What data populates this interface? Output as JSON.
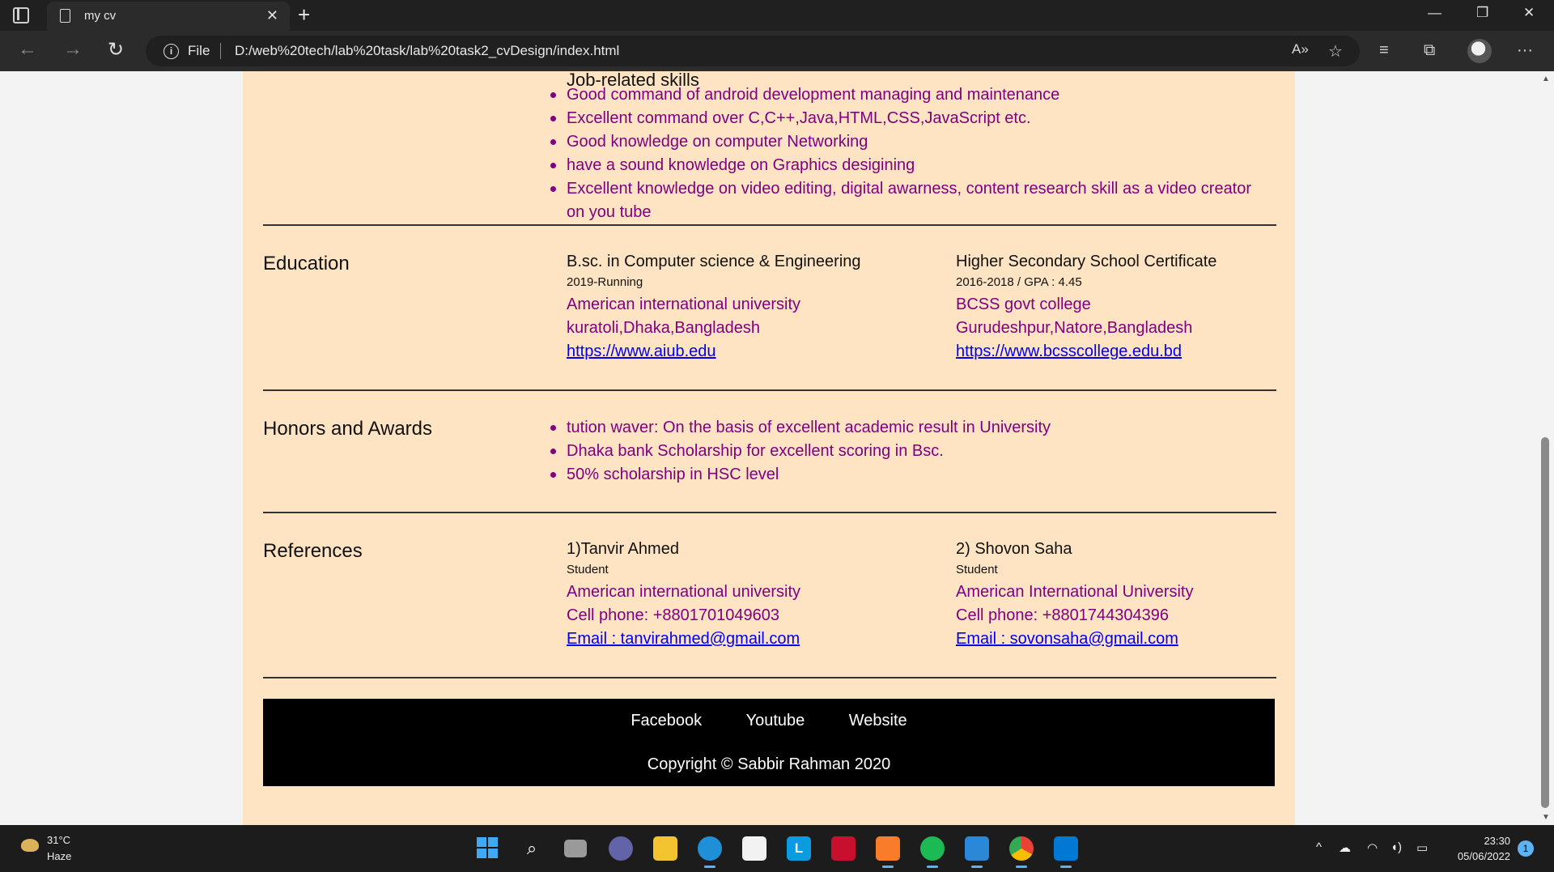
{
  "browser": {
    "tab_title": "my cv",
    "address_prefix": "File",
    "url": "D:/web%20tech/lab%20task/lab%20task2_cvDesign/index.html"
  },
  "skills": {
    "heading": "Job-related skills",
    "items": [
      "Good command of android development managing and maintenance",
      "Excellent command over C,C++,Java,HTML,CSS,JavaScript etc.",
      "Good knowledge on computer Networking",
      "have a sound knowledge on Graphics desigining",
      "Excellent knowledge on video editing, digital awarness, content research skill as a video creator on you tube"
    ]
  },
  "education": {
    "title": "Education",
    "entries": [
      {
        "degree": "B.sc. in Computer science & Engineering",
        "period": "2019-Running",
        "institution": "American international university",
        "location": "kuratoli,Dhaka,Bangladesh",
        "link": "https://www.aiub.edu"
      },
      {
        "degree": "Higher Secondary School Certificate",
        "period": "2016-2018 / GPA : 4.45",
        "institution": "BCSS govt college",
        "location": "Gurudeshpur,Natore,Bangladesh",
        "link": "https://www.bcsscollege.edu.bd"
      }
    ]
  },
  "honors": {
    "title": "Honors and Awards",
    "items": [
      "tution waver: On the basis of excellent academic result in University",
      "Dhaka bank Scholarship for excellent scoring in Bsc.",
      "50% scholarship in HSC level"
    ]
  },
  "references": {
    "title": "References",
    "entries": [
      {
        "name": "1)Tanvir Ahmed",
        "role": "Student",
        "org": "American international university",
        "phone": "Cell phone: +8801701049603",
        "email": "Email : tanvirahmed@gmail.com"
      },
      {
        "name": "2) Shovon Saha",
        "role": "Student",
        "org": "American International University",
        "phone": "Cell phone: +8801744304396",
        "email": "Email : sovonsaha@gmail.com"
      }
    ]
  },
  "footer": {
    "links": [
      "Facebook",
      "Youtube",
      "Website"
    ],
    "copyright": "Copyright © Sabbir Rahman 2020"
  },
  "taskbar": {
    "temperature": "31°C",
    "weather": "Haze",
    "time": "23:30",
    "date": "05/06/2022",
    "notifications": "1"
  }
}
